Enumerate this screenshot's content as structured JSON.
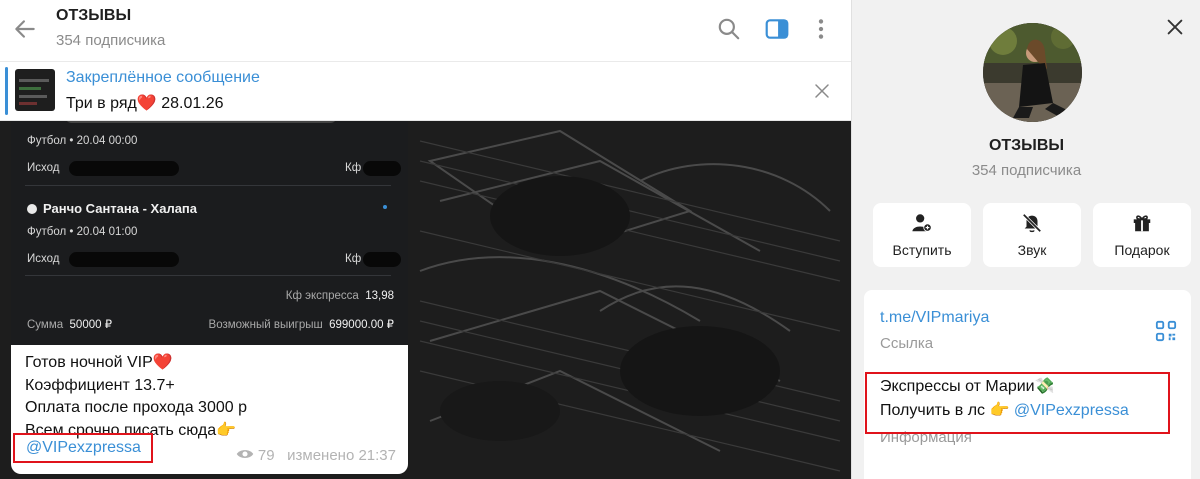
{
  "header": {
    "title": "ОТЗЫВЫ",
    "subtitle": "354 подписчика"
  },
  "pinned": {
    "label": "Закреплённое сообщение",
    "text": "Три в ряд",
    "heart": "❤️",
    "date": "28.01.26"
  },
  "message": {
    "bets": [
      {
        "sport_date": "Футбол • 20.04 00:00",
        "outcome_label": "Исход",
        "odds_label": "Кф"
      },
      {
        "match": "Ранчо Сантана - Халапа",
        "sport_date": "Футбол • 20.04 01:00",
        "outcome_label": "Исход",
        "odds_label": "Кф"
      }
    ],
    "express_label": "Кф экспресса",
    "express_value": "13,98",
    "sum_label": "Сумма",
    "sum_value": "50000 ₽",
    "win_label": "Возможный выигрыш",
    "win_value": "699000.00 ₽",
    "lines": [
      "Готов ночной VIP",
      "Коэффициент 13.7+",
      "Оплата после прохода 3000 р",
      "Всем срочно писать сюда"
    ],
    "line1_emoji": "❤️",
    "line4_emoji": "👉",
    "mention": "@VIPexzpressa",
    "views": "79",
    "edited": "изменено 21:37"
  },
  "info": {
    "title": "ОТЗЫВЫ",
    "subtitle": "354 подписчика",
    "actions": [
      "Вступить",
      "Звук",
      "Подарок"
    ],
    "link": "t.me/VIPmariya",
    "link_caption": "Ссылка",
    "desc_line1": "Экспрессы от Марии",
    "desc_line1_emoji": "💸",
    "desc_line2": "Получить в лс",
    "desc_line2_emoji": "👉",
    "desc_mention": "@VIPexzpressa",
    "desc_caption": "Информация"
  },
  "colors": {
    "accent": "#3a8fd6",
    "highlight_box": "#e0131b",
    "chat_bg": "#202020"
  }
}
